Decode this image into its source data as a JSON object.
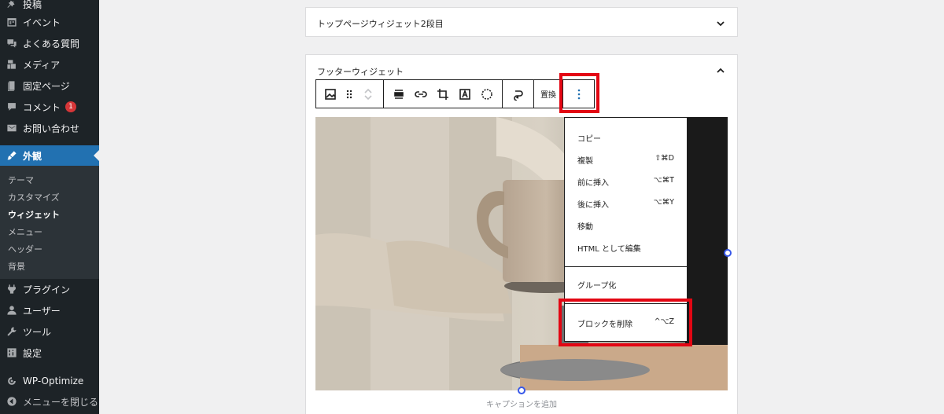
{
  "sidebar": {
    "items": [
      {
        "label": "投稿",
        "icon": "pin-icon"
      },
      {
        "label": "イベント",
        "icon": "calendar-icon"
      },
      {
        "label": "よくある質問",
        "icon": "comments-icon"
      },
      {
        "label": "メディア",
        "icon": "media-icon"
      },
      {
        "label": "固定ページ",
        "icon": "page-icon"
      },
      {
        "label": "コメント",
        "icon": "comment-icon",
        "badge": "1"
      },
      {
        "label": "お問い合わせ",
        "icon": "mail-icon"
      }
    ],
    "current": {
      "label": "外観",
      "icon": "brush-icon"
    },
    "submenu": [
      "テーマ",
      "カスタマイズ",
      "ウィジェット",
      "メニュー",
      "ヘッダー",
      "背景"
    ],
    "submenu_current": "ウィジェット",
    "lower_items": [
      {
        "label": "プラグイン",
        "icon": "plugin-icon"
      },
      {
        "label": "ユーザー",
        "icon": "user-icon"
      },
      {
        "label": "ツール",
        "icon": "wrench-icon"
      },
      {
        "label": "設定",
        "icon": "settings-icon"
      },
      {
        "label": "WP-Optimize",
        "icon": "optimize-icon"
      },
      {
        "label": "メニューを閉じる",
        "icon": "collapse-icon"
      }
    ]
  },
  "panels": {
    "top_widgets_2": "トップページウィジェット2段目",
    "footer_widget": "フッターウィジェット"
  },
  "toolbar": {
    "replace_label": "置換"
  },
  "dropdown": {
    "items": [
      {
        "label": "コピー",
        "shortcut": ""
      },
      {
        "label": "複製",
        "shortcut": "⇧⌘D"
      },
      {
        "label": "前に挿入",
        "shortcut": "⌥⌘T"
      },
      {
        "label": "後に挿入",
        "shortcut": "⌥⌘Y"
      },
      {
        "label": "移動",
        "shortcut": ""
      },
      {
        "label": "HTML として編集",
        "shortcut": ""
      }
    ],
    "group": {
      "label": "グループ化"
    },
    "remove": {
      "label": "ブロックを削除",
      "shortcut": "^⌥Z"
    }
  },
  "image": {
    "caption_placeholder": "キャプションを追加"
  },
  "colors": {
    "sidebar_bg": "#1d2327",
    "accent": "#2271b1",
    "highlight": "#e30613",
    "badge": "#d63638"
  }
}
